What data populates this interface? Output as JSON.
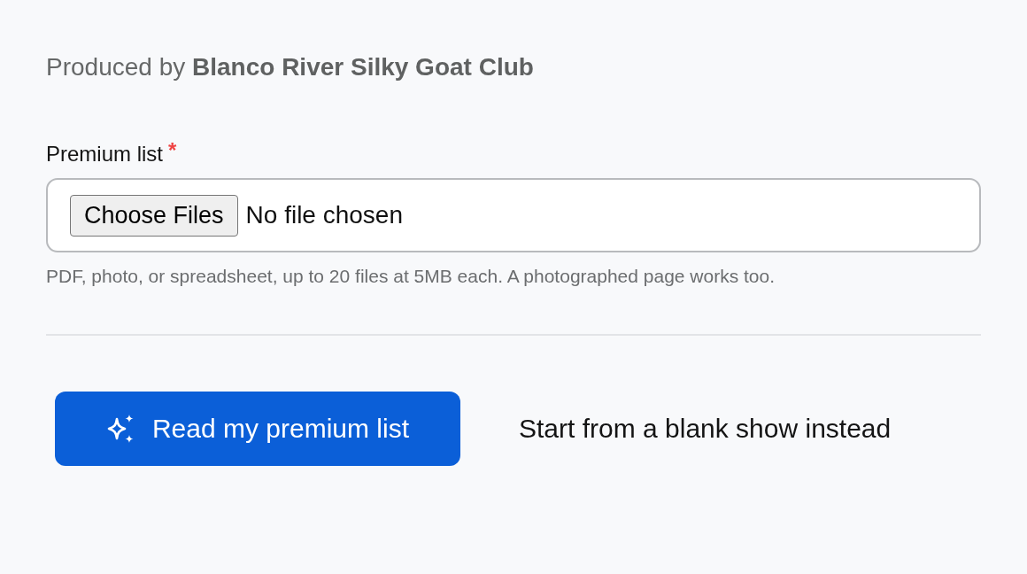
{
  "producer": {
    "text": "Produced by **Blanco River Silky Goat Club**"
  },
  "premium_list": {
    "label": "Premium list",
    "required_mark": "*",
    "choose_button": "Choose Files",
    "file_status": "No file chosen",
    "hint": "PDF, photo, or spreadsheet, up to 20 files at 5MB each. A photographed page works too."
  },
  "actions": {
    "primary": "Read my premium list",
    "secondary": "Start from a blank show instead"
  }
}
